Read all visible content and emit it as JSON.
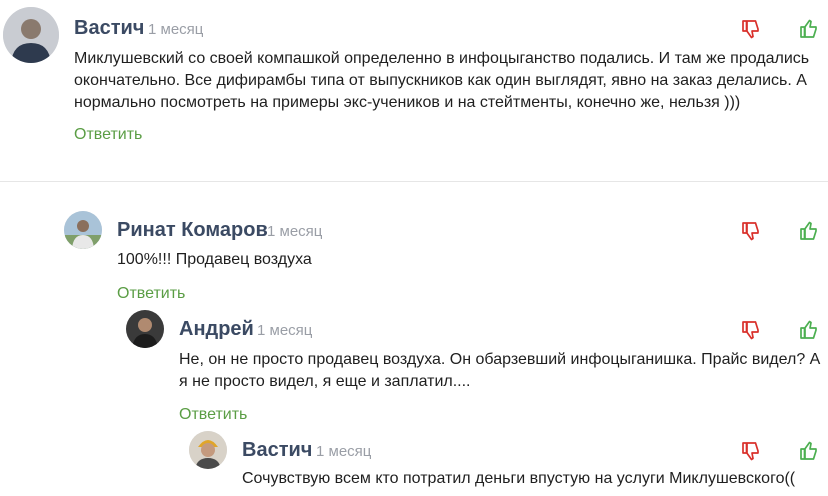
{
  "colors": {
    "author": "#3b4a63",
    "timestamp": "#9a9ea6",
    "reply": "#5a9d44",
    "dislike": "#d9302b",
    "like": "#4caf50"
  },
  "comments": [
    {
      "author": "Вастич",
      "time": "1 месяц",
      "text": "Миклушевский со своей компашкой определенно в инфоцыганство подались. И там же продались окончательно. Все дифирамбы типа от выпускников как один выглядят, явно на заказ делались. А нормально посмотреть на примеры экс-учеников и на стейтменты, конечно же, нельзя )))",
      "reply_label": "Ответить",
      "dislike_icon": "thumbs-down-icon",
      "like_icon": "thumbs-up-icon"
    },
    {
      "author": "Ринат Комаров",
      "time": "1 месяц",
      "text": "100%!!! Продавец воздуха",
      "reply_label": "Ответить",
      "dislike_icon": "thumbs-down-icon",
      "like_icon": "thumbs-up-icon"
    },
    {
      "author": "Андрей",
      "time": "1 месяц",
      "text": "Не, он не просто продавец воздуха. Он обарзевший инфоцыганишка. Прайс видел? А я не просто видел, я еще и заплатил....",
      "reply_label": "Ответить",
      "dislike_icon": "thumbs-down-icon",
      "like_icon": "thumbs-up-icon"
    },
    {
      "author": "Вастич",
      "time": "1 месяц",
      "text": "Сочувствую всем кто потратил деньги впустую на услуги Миклушевского((",
      "dislike_icon": "thumbs-down-icon",
      "like_icon": "thumbs-up-icon"
    }
  ]
}
